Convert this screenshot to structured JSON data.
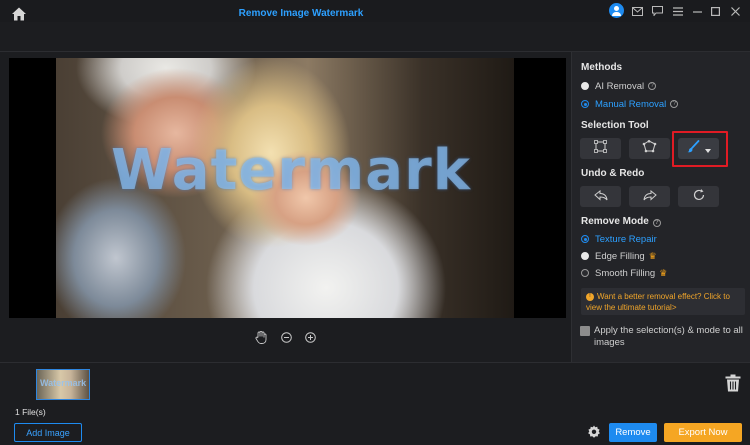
{
  "window": {
    "icons": [
      "user-avatar-icon",
      "mail-icon",
      "message-icon",
      "menu-icon",
      "minimize-icon",
      "maximize-icon",
      "close-icon"
    ]
  },
  "header": {
    "title": "Remove Image Watermark"
  },
  "canvas": {
    "watermark_text": "Watermark"
  },
  "panel": {
    "methods_title": "Methods",
    "methods": [
      {
        "label": "AI Removal",
        "selected": false
      },
      {
        "label": "Manual Removal",
        "selected": true
      }
    ],
    "selection_tool_title": "Selection Tool",
    "selection_tools": [
      "rectangle-select-icon",
      "lasso-select-icon",
      "brush-select-icon"
    ],
    "active_tool": "brush-select-icon",
    "undo_redo_title": "Undo & Redo",
    "undo_redo": [
      "undo-icon",
      "redo-icon",
      "reset-icon"
    ],
    "remove_mode_title": "Remove Mode",
    "remove_modes": [
      {
        "label": "Texture Repair",
        "selected": true,
        "premium": false
      },
      {
        "label": "Edge Filling",
        "selected": false,
        "premium": true
      },
      {
        "label": "Smooth Filling",
        "selected": false,
        "premium": true
      }
    ],
    "tip": "Want a better removal effect? Click to view the ultimate tutorial>",
    "apply_label": "Apply the selection(s) & mode to all images",
    "apply_checked": false
  },
  "files": {
    "count_label": "1 File(s)",
    "thumb_watermark": "Watermark"
  },
  "bottom": {
    "add_image_label": "Add Image",
    "remove_label": "Remove",
    "export_label": "Export Now"
  },
  "colors": {
    "accent": "#1e8bf0",
    "export": "#f5a623",
    "highlight": "#e01b24",
    "tip_text": "#f0a52a"
  }
}
